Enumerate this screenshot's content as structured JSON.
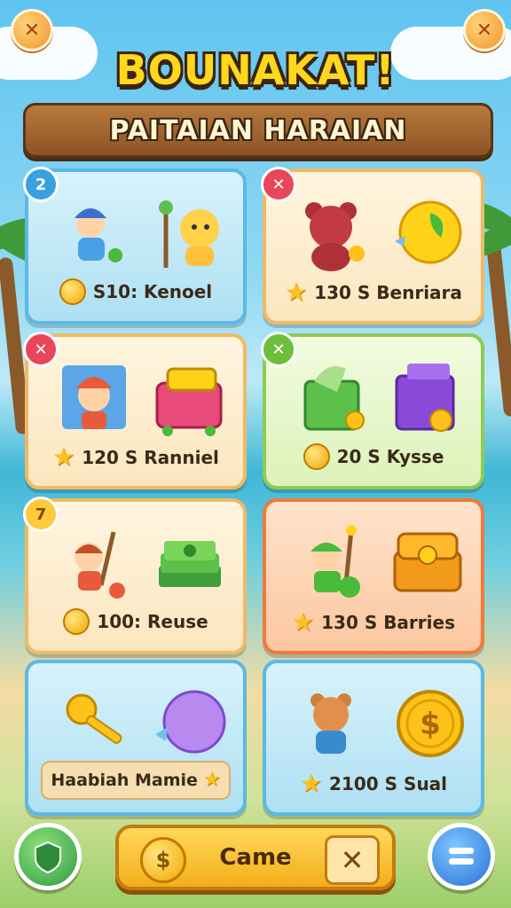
{
  "header": {
    "title": "BOUNAKAT!",
    "banner": "PAITAIAN HARAIAN",
    "close_left": "✕",
    "close_right": "✕"
  },
  "cards": [
    {
      "badge": "2",
      "reward": "S10: Kenoel"
    },
    {
      "badge": "✕",
      "reward": "130 S Benriara"
    },
    {
      "badge": "✕",
      "reward": "120 S Ranniel"
    },
    {
      "badge": "✕",
      "reward": "20 S Kysse"
    },
    {
      "badge": "7",
      "reward": "100: Reuse"
    },
    {
      "badge": "",
      "reward": "130 S Barries"
    },
    {
      "badge": "",
      "reward": "Haabiah Mamie"
    },
    {
      "badge": "",
      "reward": "2100 S Sual"
    }
  ],
  "bottom": {
    "label": "Came",
    "coin": "$",
    "x": "✕"
  },
  "colors": {
    "title": "#ffd81e",
    "banner": "#8c5425",
    "blue_card": "#5ab9e6",
    "orange_card": "#ef7a3a",
    "green_card": "#8ccc55"
  }
}
